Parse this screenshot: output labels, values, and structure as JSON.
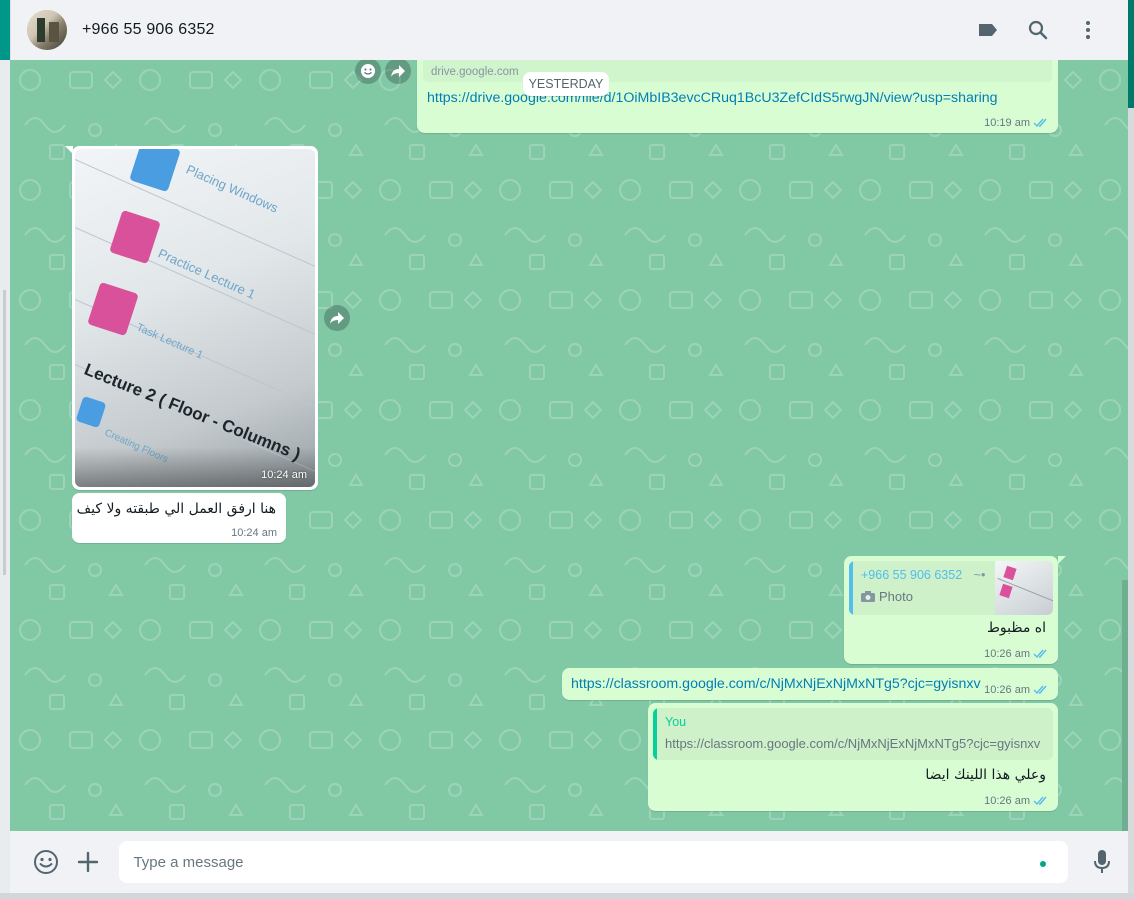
{
  "header": {
    "contact_name": "+966 55 906 6352",
    "icons": [
      "label-icon",
      "search-icon",
      "menu-icon"
    ]
  },
  "chat": {
    "day_label": "YESTERDAY",
    "msg1": {
      "link_preview_domain": "drive.google.com",
      "link": "https://drive.google.com/file/d/1OiMbIB3evcCRuq1BcU3ZefCIdS5rwgJN/view?usp=sharing",
      "time": "10:19 am"
    },
    "photo_msg": {
      "photo_texts": [
        "Placing Windows",
        "Practice Lecture 1",
        "Task Lecture 1",
        "Lecture 2 ( Floor - Columns )",
        "Creating Floors"
      ],
      "time": "10:24 am"
    },
    "msg_in_text": {
      "text": "هنا ارفق العمل الي طبقته ولا كيف",
      "time": "10:24 am"
    },
    "msg_reply1": {
      "quoted_author": "+966 55 906 6352",
      "quoted_suffix": "~•",
      "quoted_type": "Photo",
      "text": "اه مظبوط",
      "time": "10:26 am"
    },
    "msg_link2": {
      "link": "https://classroom.google.com/c/NjMxNjExNjMxNTg5?cjc=gyisnxv",
      "time": "10:26 am"
    },
    "msg_reply2": {
      "quoted_author": "You",
      "quoted_text": "https://classroom.google.com/c/NjMxNjExNjMxNTg5?cjc=gyisnxv",
      "text": "وعلي هذا اللينك ايضا",
      "time": "10:26 am"
    }
  },
  "footer": {
    "placeholder": "Type a message",
    "icons": [
      "emoji-icon",
      "attach-plus-icon",
      "mic-icon"
    ]
  },
  "colors": {
    "chat_bg": "#81c8a5",
    "outgoing_bubble": "#d9fdd3",
    "incoming_bubble": "#ffffff",
    "link": "#027eb5",
    "accent": "#00a884"
  }
}
